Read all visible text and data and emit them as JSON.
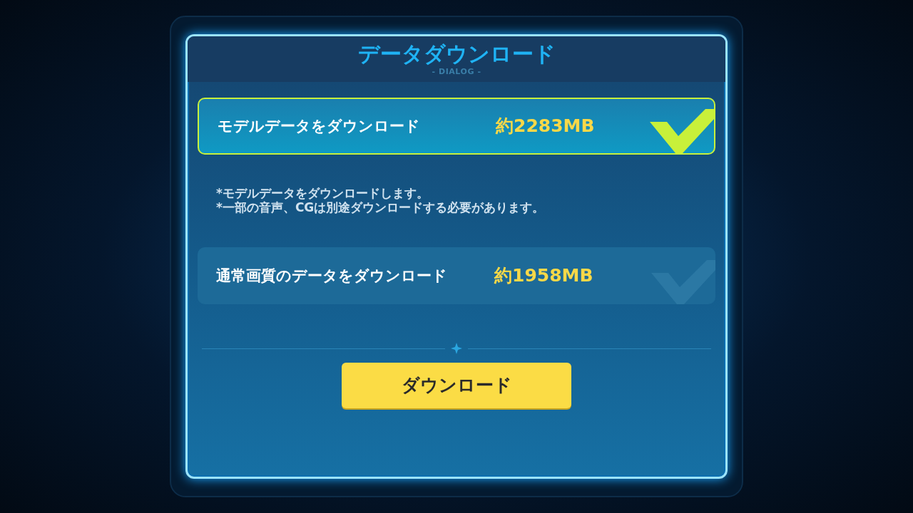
{
  "dialog": {
    "title": "データダウンロード",
    "subtitle": "- DIALOG -"
  },
  "options": [
    {
      "label": "モデルデータをダウンロード",
      "size": "約2283MB",
      "selected": true,
      "notes": [
        "*モデルデータをダウンロードします。",
        "*一部の音声、CGは別途ダウンロードする必要があります。"
      ]
    },
    {
      "label": "通常画質のデータをダウンロード",
      "size": "約1958MB",
      "selected": false
    }
  ],
  "button": {
    "label": "ダウンロード"
  }
}
